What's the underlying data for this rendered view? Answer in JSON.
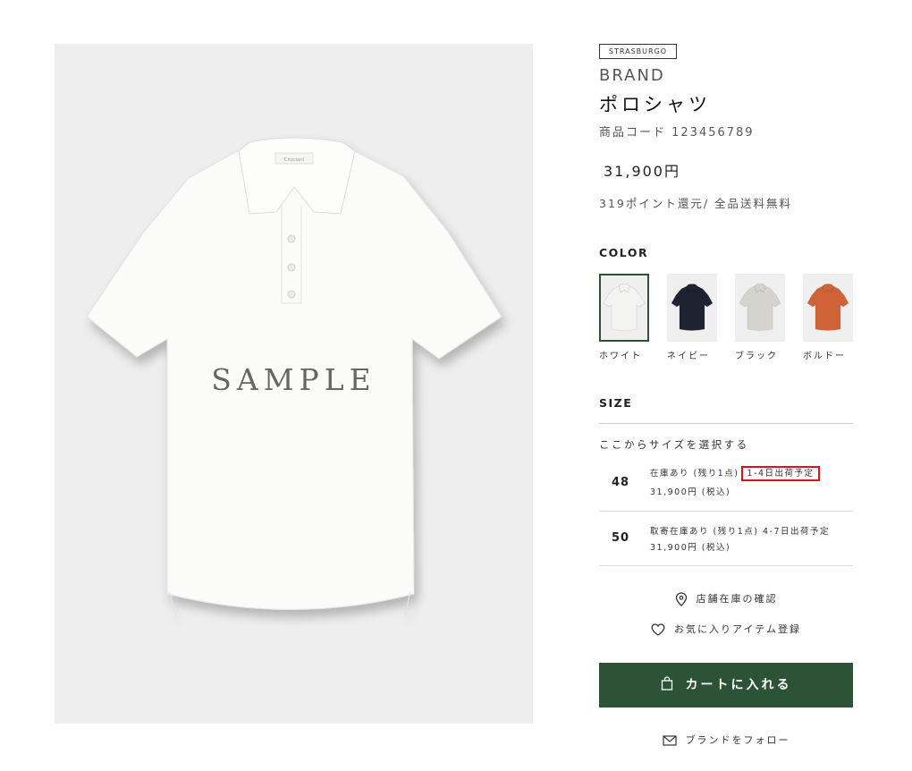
{
  "image": {
    "overlay_text": "SAMPLE",
    "collar_tag_text": "Cruciani"
  },
  "product": {
    "brand_tag": "STRASBURGO",
    "brand": "BRAND",
    "name": "ポロシャツ",
    "code": "商品コード 123456789",
    "price": "31,900円",
    "points": "319ポイント還元/ 全品送料無料"
  },
  "colors": {
    "title": "COLOR",
    "items": [
      {
        "label": "ホワイト",
        "shirt_color": "#f3f3f1",
        "selected": true
      },
      {
        "label": "ネイビー",
        "shirt_color": "#1f2230",
        "selected": false
      },
      {
        "label": "ブラック",
        "shirt_color": "#d4d3cd",
        "selected": false
      },
      {
        "label": "ボルドー",
        "shirt_color": "#cf6337",
        "selected": false
      }
    ]
  },
  "sizes": {
    "title": "SIZE",
    "prompt": "ここからサイズを選択する",
    "rows": [
      {
        "size": "48",
        "stock": "在庫あり (残り1点)",
        "shipping": "1-4日出荷予定",
        "price": "31,900円 (税込)"
      },
      {
        "size": "50",
        "stock": "取寄在庫あり (残り1点) 4-7日出荷予定",
        "price": "31,900円 (税込)"
      }
    ]
  },
  "actions": {
    "store_stock": "店舗在庫の確認",
    "favorite": "お気に入りアイテム登録",
    "add_to_cart": "カートに入れる",
    "follow_brand": "ブランドをフォロー"
  },
  "colors_theme": {
    "accent": "#2d5336",
    "highlight": "#d9141c"
  }
}
